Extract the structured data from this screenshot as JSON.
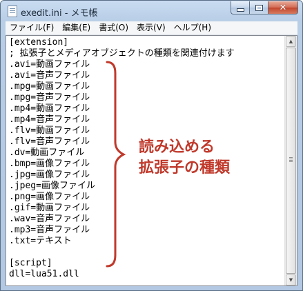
{
  "window": {
    "title": "exedit.ini - メモ帳",
    "icon": "notepad-icon",
    "buttons": {
      "minimize": "minimize",
      "maximize": "maximize",
      "close": "✕"
    }
  },
  "menu": [
    {
      "label": "ファイル(F)"
    },
    {
      "label": "編集(E)"
    },
    {
      "label": "書式(O)"
    },
    {
      "label": "表示(V)"
    },
    {
      "label": "ヘルプ(H)"
    }
  ],
  "editor": {
    "lines": [
      "[extension]",
      "; 拡張子とメディアオブジェクトの種類を関連付けます",
      ".avi=動画ファイル",
      ".avi=音声ファイル",
      ".mpg=動画ファイル",
      ".mpg=音声ファイル",
      ".mp4=動画ファイル",
      ".mp4=音声ファイル",
      ".flv=動画ファイル",
      ".flv=音声ファイル",
      ".dv=動画ファイル",
      ".bmp=画像ファイル",
      ".jpg=画像ファイル",
      ".jpeg=画像ファイル",
      ".png=画像ファイル",
      ".gif=動画ファイル",
      ".wav=音声ファイル",
      ".mp3=音声ファイル",
      ".txt=テキスト",
      "",
      "[script]",
      "dll=lua51.dll"
    ]
  },
  "scrollbar": {
    "up_arrow": "▲",
    "down_arrow": "▼"
  },
  "annotation": {
    "line1": "読み込める",
    "line2": "拡張子の種類",
    "color": "#c0392b"
  }
}
